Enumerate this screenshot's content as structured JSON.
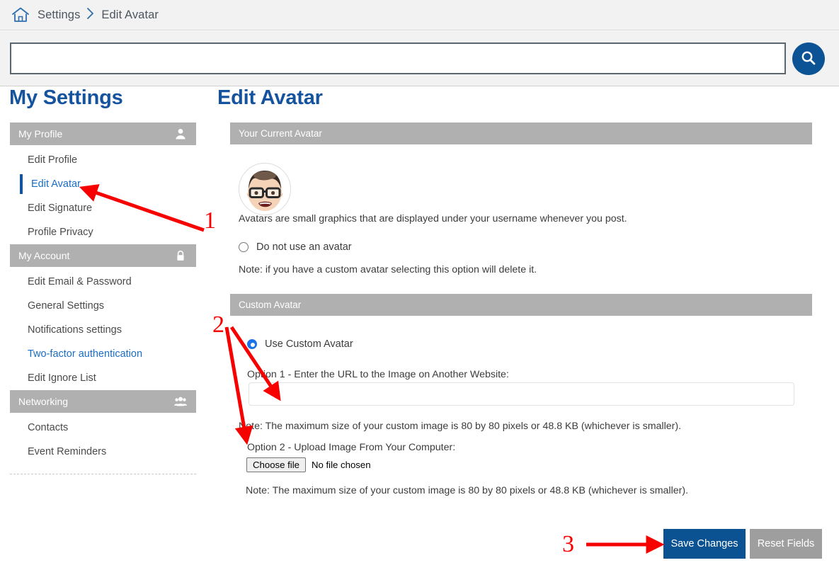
{
  "breadcrumb": {
    "home_icon": "home-icon",
    "items": [
      "Settings",
      "Edit Avatar"
    ],
    "separator": "›"
  },
  "search": {
    "value": "",
    "placeholder": "",
    "button_icon": "search-icon"
  },
  "sidebar": {
    "title": "My Settings",
    "groups": [
      {
        "header": "My Profile",
        "icon": "user-icon",
        "items": [
          {
            "label": "Edit Profile",
            "state": "normal"
          },
          {
            "label": "Edit Avatar",
            "state": "active"
          },
          {
            "label": "Edit Signature",
            "state": "normal"
          },
          {
            "label": "Profile Privacy",
            "state": "normal"
          }
        ]
      },
      {
        "header": "My Account",
        "icon": "lock-icon",
        "items": [
          {
            "label": "Edit Email & Password",
            "state": "normal"
          },
          {
            "label": "General Settings",
            "state": "normal"
          },
          {
            "label": "Notifications settings",
            "state": "normal"
          },
          {
            "label": "Two-factor authentication",
            "state": "link"
          },
          {
            "label": "Edit Ignore List",
            "state": "normal"
          }
        ]
      },
      {
        "header": "Networking",
        "icon": "group-icon",
        "items": [
          {
            "label": "Contacts",
            "state": "normal"
          },
          {
            "label": "Event Reminders",
            "state": "normal"
          }
        ]
      }
    ]
  },
  "main": {
    "title": "Edit Avatar",
    "current_panel": {
      "header": "Your Current Avatar",
      "avatar_alt": "user-avatar",
      "description": "Avatars are small graphics that are displayed under your username whenever you post.",
      "no_avatar_option": "Do not use an avatar",
      "no_avatar_selected": false,
      "no_avatar_note": "Note: if you have a custom avatar selecting this option will delete it."
    },
    "custom_panel": {
      "header": "Custom Avatar",
      "use_custom_option": "Use Custom Avatar",
      "use_custom_selected": true,
      "option1_label": "Option 1 - Enter the URL to the Image on Another Website:",
      "url_value": "",
      "url_placeholder": "",
      "option1_note": "Note: The maximum size of your custom image is 80 by 80 pixels or 48.8 KB (whichever is smaller).",
      "option2_label": "Option 2 - Upload Image From Your Computer:",
      "file_button": "Choose file",
      "file_status": "No file chosen",
      "option2_note": "Note: The maximum size of your custom image is 80 by 80 pixels or 48.8 KB (whichever is smaller)."
    },
    "actions": {
      "save_label": "Save Changes",
      "reset_label": "Reset Fields"
    }
  },
  "annotations": {
    "markers": [
      {
        "number": "1",
        "points_to": "sidebar-item-edit-avatar"
      },
      {
        "number": "2",
        "points_to": "custom-avatar-inputs"
      },
      {
        "number": "3",
        "points_to": "save-changes-button"
      }
    ],
    "color": "#f60000"
  },
  "colors": {
    "brand_blue": "#15539e",
    "link_blue": "#1a6dc4",
    "panel_gray": "#b0b0b0",
    "save_blue": "#0b5293",
    "reset_gray": "#9e9e9e",
    "annotation_red": "#f60000"
  }
}
